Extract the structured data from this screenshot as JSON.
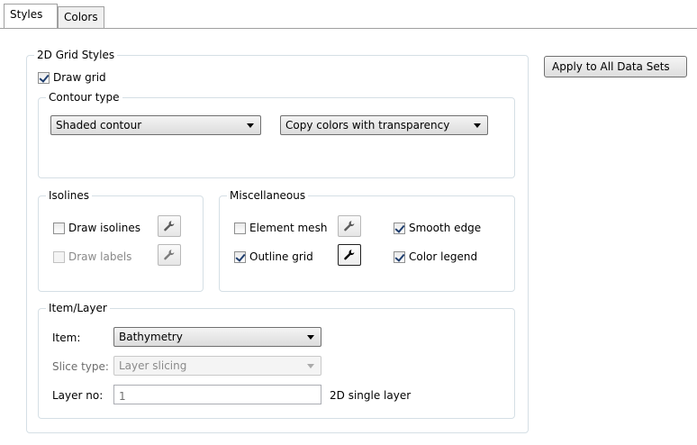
{
  "tabs": [
    {
      "label": "Styles",
      "active": true
    },
    {
      "label": "Colors",
      "active": false
    }
  ],
  "grid_styles": {
    "title": "2D Grid Styles",
    "draw_grid": {
      "label": "Draw grid",
      "checked": true
    }
  },
  "contour": {
    "title": "Contour type",
    "type_value": "Shaded contour",
    "color_value": "Copy colors with transparency"
  },
  "isolines": {
    "title": "Isolines",
    "draw_isolines": {
      "label": "Draw isolines",
      "checked": false
    },
    "draw_labels": {
      "label": "Draw labels",
      "checked": false,
      "enabled": false
    }
  },
  "misc": {
    "title": "Miscellaneous",
    "element_mesh": {
      "label": "Element mesh",
      "checked": false
    },
    "outline_grid": {
      "label": "Outline grid",
      "checked": true
    },
    "smooth_edge": {
      "label": "Smooth edge",
      "checked": true
    },
    "color_legend": {
      "label": "Color legend",
      "checked": true
    }
  },
  "item_layer": {
    "title": "Item/Layer",
    "item_label": "Item:",
    "item_value": "Bathymetry",
    "slice_label": "Slice type:",
    "slice_value": "Layer slicing",
    "layer_label": "Layer no:",
    "layer_value": "1",
    "layer_note": "2D single layer"
  },
  "apply_button": "Apply to All Data Sets",
  "icons": {
    "wrench": "wrench-icon",
    "dropdown": "chevron-down-icon",
    "check": "check-icon"
  },
  "colors": {
    "group_border": "#d5dfe5",
    "check_mark": "#1e3d6e",
    "disabled_text": "#8a8a8a"
  }
}
